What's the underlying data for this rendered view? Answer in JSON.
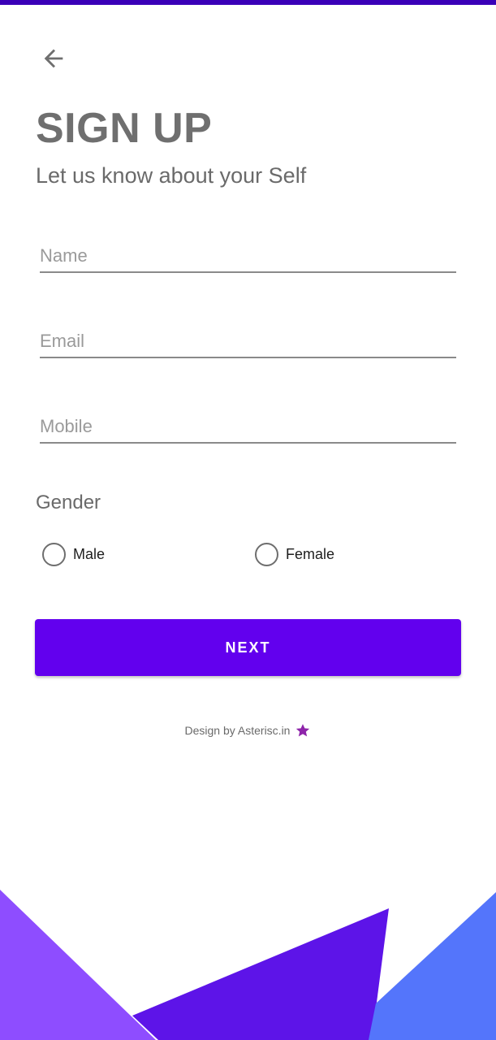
{
  "colors": {
    "primary": "#6200ee",
    "top_bar": "#3a00b8",
    "shape_left": "#8e4dff",
    "shape_middle": "#5d14e8",
    "shape_right": "#5475fb",
    "star": "#8e24aa"
  },
  "header": {
    "back_icon": "arrow-left-icon",
    "title": "SIGN UP",
    "subtitle": "Let us know about your Self"
  },
  "form": {
    "name_placeholder": "Name",
    "email_placeholder": "Email",
    "mobile_placeholder": "Mobile",
    "gender_label": "Gender",
    "gender_options": [
      "Male",
      "Female"
    ],
    "next_label": "NEXT"
  },
  "footer": {
    "credit_text": "Design by Asterisc.in",
    "credit_icon": "star-icon"
  }
}
